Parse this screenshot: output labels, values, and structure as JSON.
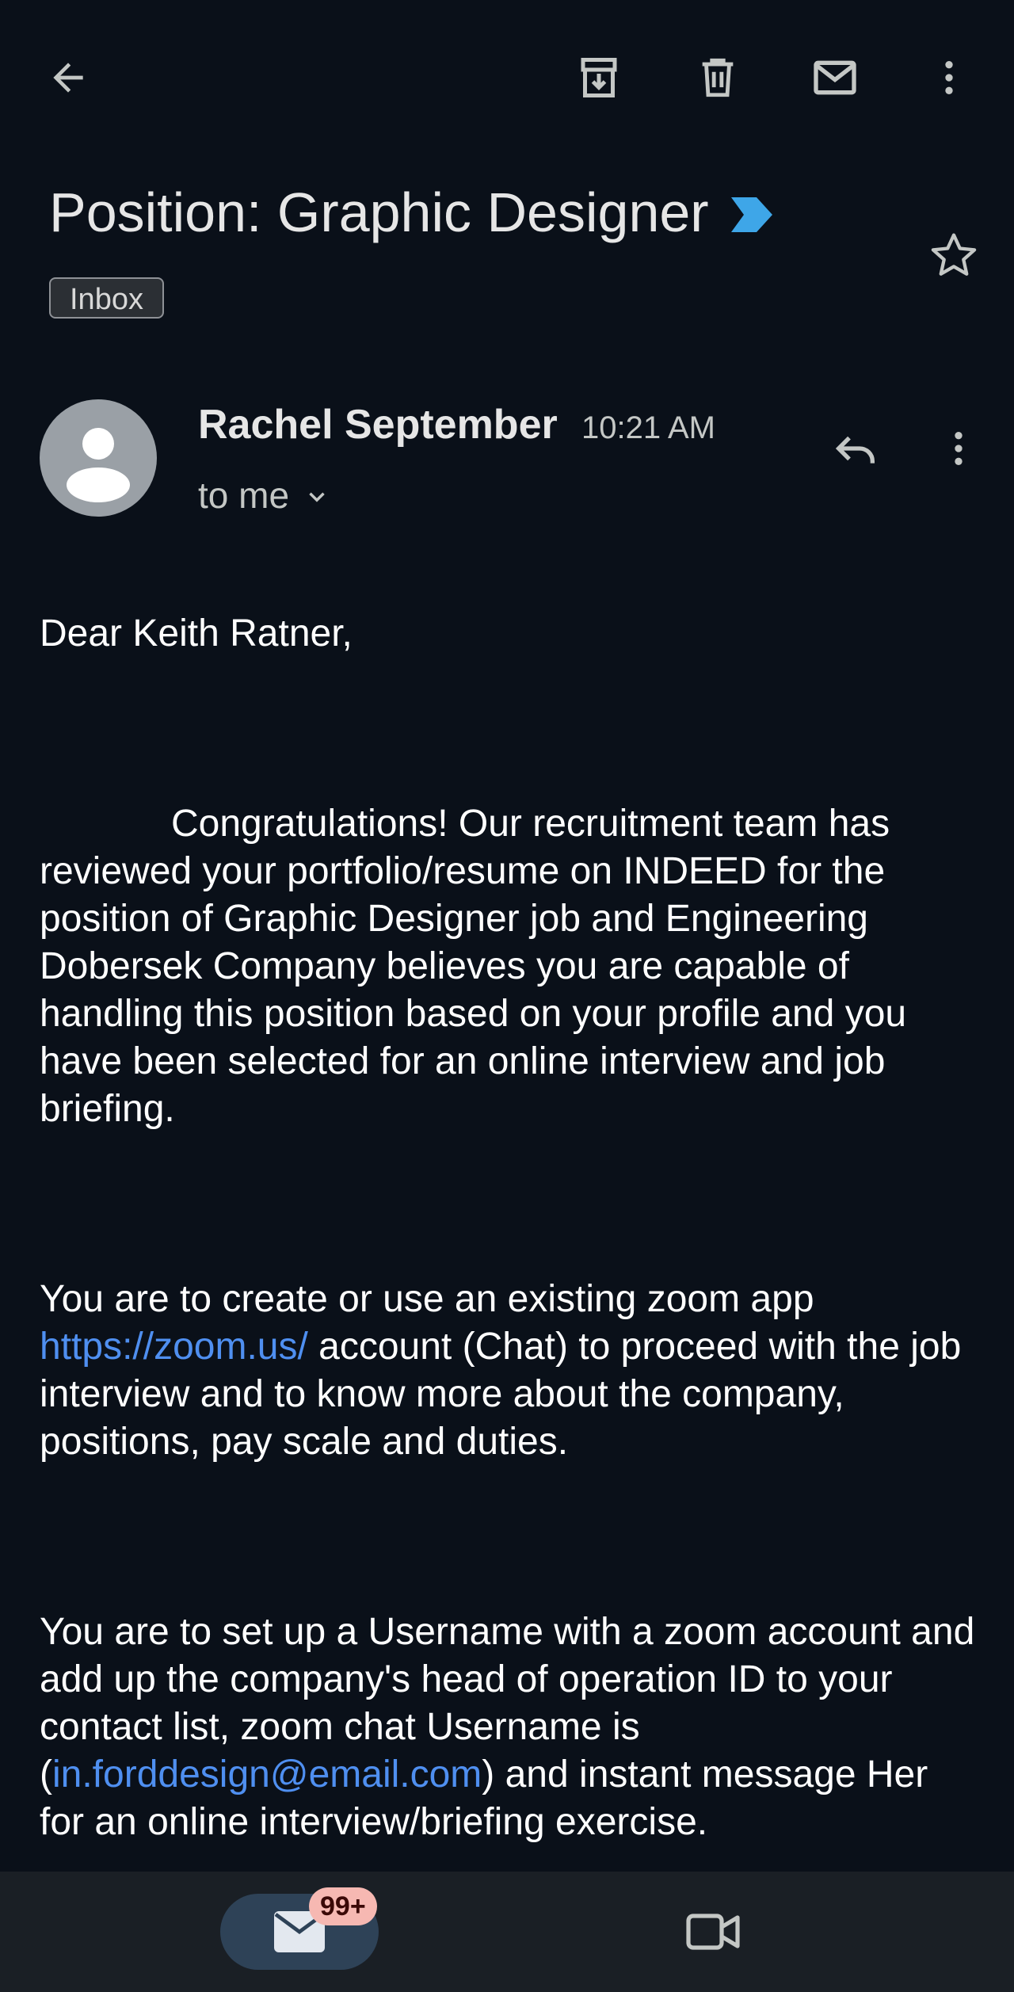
{
  "toolbar": {
    "back_icon": "arrow-left-icon",
    "archive_icon": "archive-icon",
    "delete_icon": "trash-icon",
    "mark_unread_icon": "mail-icon",
    "more_icon": "more-vertical-icon"
  },
  "subject": {
    "title": "Position: Graphic Designer",
    "importance_icon": "importance-marker-icon",
    "label_chip": "Inbox",
    "star_icon": "star-outline-icon"
  },
  "sender": {
    "name": "Rachel September",
    "time": "10:21 AM",
    "recipient": "to me",
    "avatar_icon": "person-avatar-icon",
    "reply_icon": "reply-icon",
    "more_icon": "more-vertical-icon"
  },
  "body": {
    "greeting": "Dear Keith Ratner,",
    "congrats": "Congratulations! Our recruitment team has reviewed your portfolio/resume on INDEED for the position of Graphic Designer job and Engineering Dobersek Company believes you are capable of handling this position based on your profile and you have been selected for an online interview and job briefing.",
    "zoom_pre": "You are to create or use an existing zoom app ",
    "zoom_link": "https://zoom.us/",
    "zoom_post": " account (Chat) to proceed with the job interview and to know more about the company, positions, pay scale and duties.",
    "username_pre": "You are to set up a Username with a zoom account and add up the company's head of operation ID to your contact list, zoom chat Username is (",
    "username_email": "in.forddesign@email.com",
    "username_post": ") and instant message Her for an online interview/briefing exercise."
  },
  "bottom_nav": {
    "mail_icon": "mail-filled-icon",
    "mail_badge": "99+",
    "meet_icon": "video-camera-icon"
  },
  "colors": {
    "background": "#0a1019",
    "link": "#4f8ff0",
    "importance": "#3ea6e8",
    "nav_active": "#2e4257",
    "badge": "#f6b8b2"
  }
}
